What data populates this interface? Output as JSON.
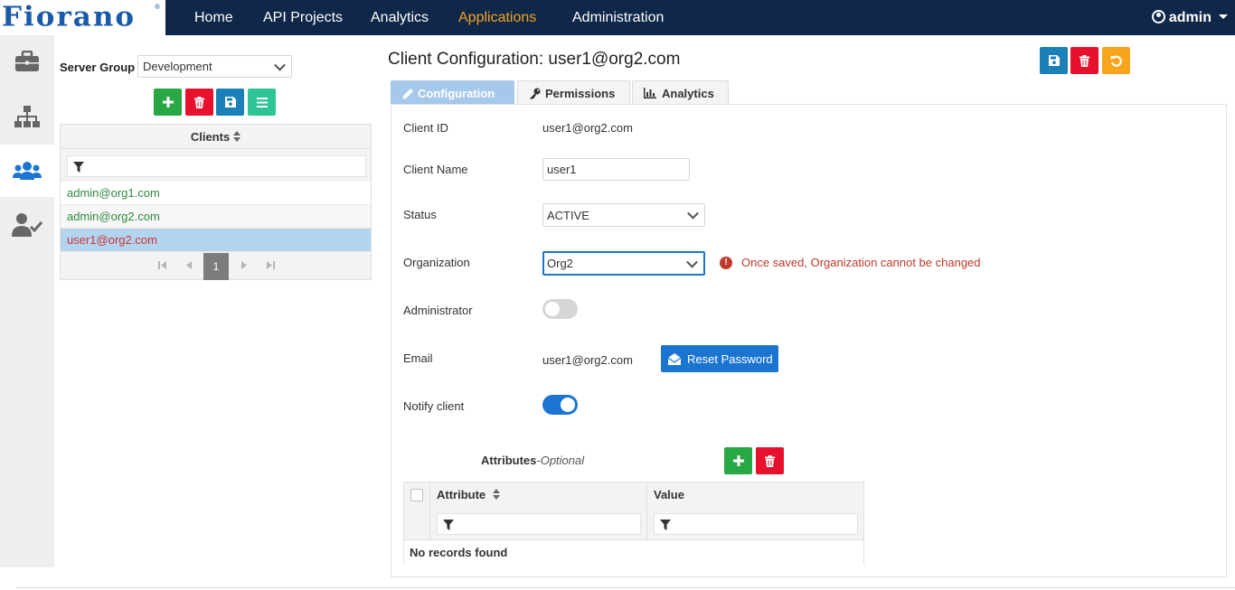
{
  "brand": {
    "logo_text": "Fiorano",
    "reg_mark": "®",
    "accent": "#f5a623",
    "navbar_bg": "#0f2748"
  },
  "nav": {
    "items": [
      {
        "label": "Home"
      },
      {
        "label": "API Projects"
      },
      {
        "label": "Analytics"
      },
      {
        "label": "Applications",
        "active": true
      },
      {
        "label": "Administration"
      }
    ],
    "user": "admin"
  },
  "sidebar": {
    "items": [
      {
        "icon": "briefcase-icon"
      },
      {
        "icon": "sitemap-icon"
      },
      {
        "icon": "users-icon",
        "active": true
      },
      {
        "icon": "user-check-icon"
      }
    ]
  },
  "left_panel": {
    "server_group_label": "Server Group",
    "server_group_value": "Development",
    "grid": {
      "header": "Clients",
      "rows": [
        "admin@org1.com",
        "admin@org2.com",
        "user1@org2.com"
      ],
      "selected_index": 2,
      "page": "1"
    }
  },
  "main": {
    "title": "Client Configuration: user1@org2.com",
    "tabs": [
      {
        "label": "Configuration",
        "active": true
      },
      {
        "label": "Permissions"
      },
      {
        "label": "Analytics"
      }
    ],
    "form": {
      "client_id_label": "Client ID",
      "client_id_value": "user1@org2.com",
      "client_name_label": "Client Name",
      "client_name_value": "user1",
      "status_label": "Status",
      "status_value": "ACTIVE",
      "organization_label": "Organization",
      "organization_value": "Org2",
      "organization_warning": "Once saved, Organization cannot be changed",
      "administrator_label": "Administrator",
      "administrator_on": false,
      "email_label": "Email",
      "email_value": "user1@org2.com",
      "reset_password_label": "Reset Password",
      "notify_label": "Notify client",
      "notify_on": true
    },
    "attributes": {
      "title": "Attributes",
      "optional": "-Optional",
      "col_attribute": "Attribute",
      "col_value": "Value",
      "empty_text": "No records found"
    }
  }
}
